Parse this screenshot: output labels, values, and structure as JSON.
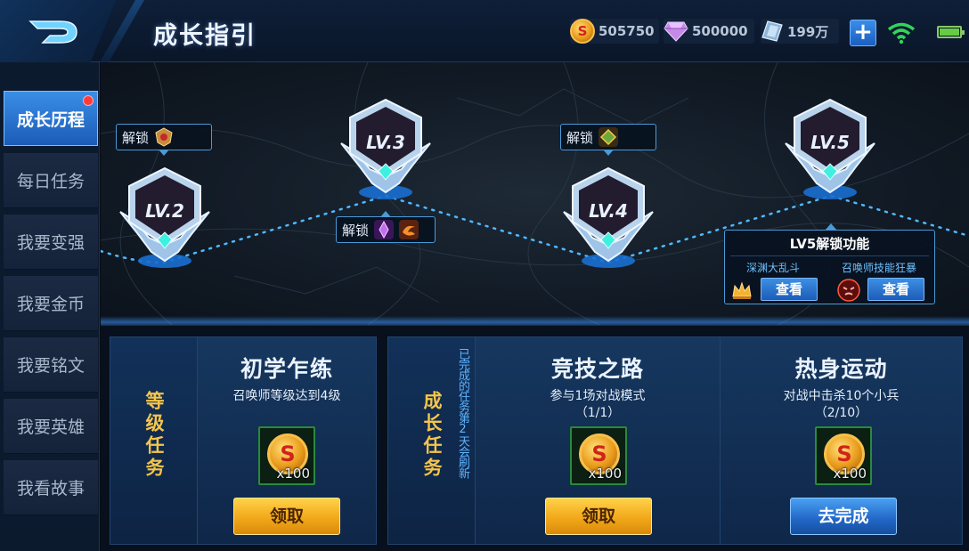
{
  "header": {
    "title": "成长指引",
    "currencies": [
      {
        "icon": "gold-coin-icon",
        "value": "505750"
      },
      {
        "icon": "diamond-icon",
        "value": "500000"
      },
      {
        "icon": "voucher-icon",
        "value": "199万"
      }
    ],
    "plus_label": "+"
  },
  "sidebar": {
    "items": [
      {
        "label": "成长历程",
        "active": true,
        "has_dot": true
      },
      {
        "label": "每日任务"
      },
      {
        "label": "我要变强"
      },
      {
        "label": "我要金币"
      },
      {
        "label": "我要铭文"
      },
      {
        "label": "我要英雄"
      },
      {
        "label": "我看故事"
      }
    ]
  },
  "levels": [
    {
      "label": "LV.2",
      "unlock": "解锁"
    },
    {
      "label": "LV.3",
      "unlock": "解锁"
    },
    {
      "label": "LV.4",
      "unlock": "解锁"
    },
    {
      "label": "LV.5"
    }
  ],
  "lv5_panel": {
    "title": "LV5解锁功能",
    "features": [
      {
        "name": "深渊大乱斗",
        "button": "查看",
        "icon": "crown-icon"
      },
      {
        "name": "召唤师技能狂暴",
        "button": "查看",
        "icon": "rage-icon"
      }
    ]
  },
  "task_groups": [
    {
      "label": "等级任务",
      "tasks": [
        {
          "title": "初学乍练",
          "desc": "召唤师等级达到4级",
          "progress": "",
          "reward_qty": "x100",
          "button": "领取",
          "button_type": "claim"
        }
      ]
    },
    {
      "label": "成长任务",
      "note": "已完成的任务第2天会刷新",
      "tasks": [
        {
          "title": "竞技之路",
          "desc": "参与1场对战模式",
          "progress": "（1/1）",
          "reward_qty": "x100",
          "button": "领取",
          "button_type": "claim"
        },
        {
          "title": "热身运动",
          "desc": "对战中击杀10个小兵",
          "progress": "（2/10）",
          "reward_qty": "x100",
          "button": "去完成",
          "button_type": "go"
        }
      ]
    }
  ],
  "colors": {
    "accent_blue": "#3a8ee6",
    "gold": "#f6c54a",
    "claim_button": "#f2a81a",
    "go_button": "#2166c6"
  }
}
